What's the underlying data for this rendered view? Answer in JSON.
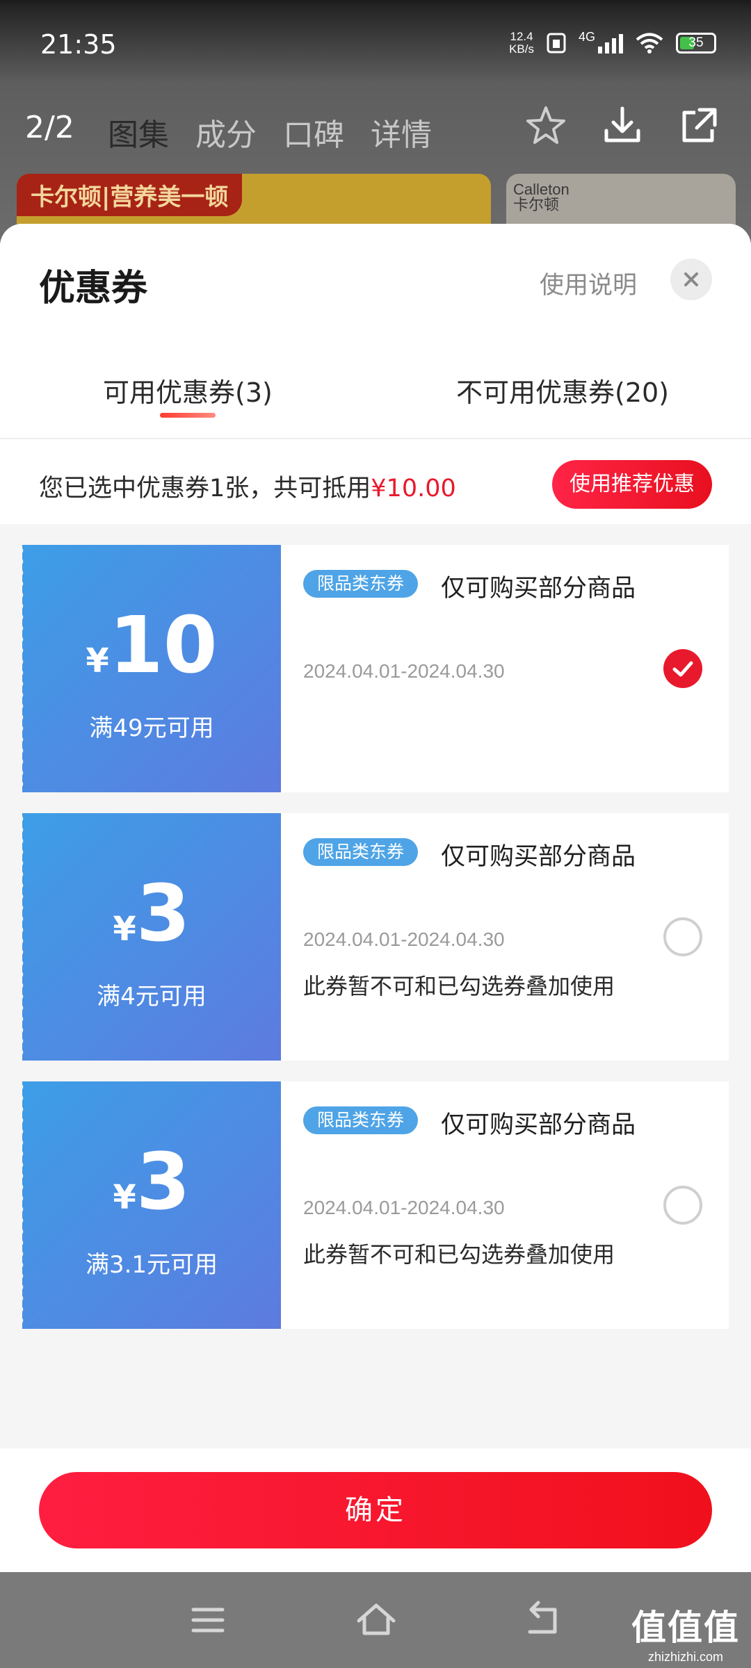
{
  "status_bar": {
    "time": "21:35",
    "net_speed_value": "12.4",
    "net_speed_unit": "KB/s",
    "network": "4G",
    "battery": "35"
  },
  "background_page": {
    "counter": "2/2",
    "tabs": [
      "图集",
      "成分",
      "口碑",
      "详情"
    ],
    "active_tab_index": 0,
    "banner_tag": "卡尔顿|营养美一顿",
    "banner2_logo_line1": "Calleton",
    "banner2_logo_line2": "卡尔顿"
  },
  "sheet": {
    "title": "优惠券",
    "usage_link": "使用说明",
    "tabs": [
      {
        "label": "可用优惠券(3)",
        "active": true
      },
      {
        "label": "不可用优惠券(20)",
        "active": false
      }
    ],
    "summary": {
      "text": "您已选中优惠券1张，共可抵用",
      "amount": "¥10.00",
      "recommend_button": "使用推荐优惠"
    },
    "coupons": [
      {
        "currency": "¥",
        "amount": "10",
        "condition": "满49元可用",
        "badge": "限品类东券",
        "title": "仅可购买部分商品",
        "date": "2024.04.01-2024.04.30",
        "note": "",
        "checked": true
      },
      {
        "currency": "¥",
        "amount": "3",
        "condition": "满4元可用",
        "badge": "限品类东券",
        "title": "仅可购买部分商品",
        "date": "2024.04.01-2024.04.30",
        "note": "此券暂不可和已勾选券叠加使用",
        "checked": false
      },
      {
        "currency": "¥",
        "amount": "3",
        "condition": "满3.1元可用",
        "badge": "限品类东券",
        "title": "仅可购买部分商品",
        "date": "2024.04.01-2024.04.30",
        "note": "此券暂不可和已勾选券叠加使用",
        "checked": false
      }
    ],
    "confirm_button": "确定"
  },
  "watermark": {
    "big": "值值值",
    "small": "zhizhizhi.com"
  },
  "colors": {
    "accent_red": "#e8192c",
    "coupon_blue": "#4a8ee4"
  }
}
